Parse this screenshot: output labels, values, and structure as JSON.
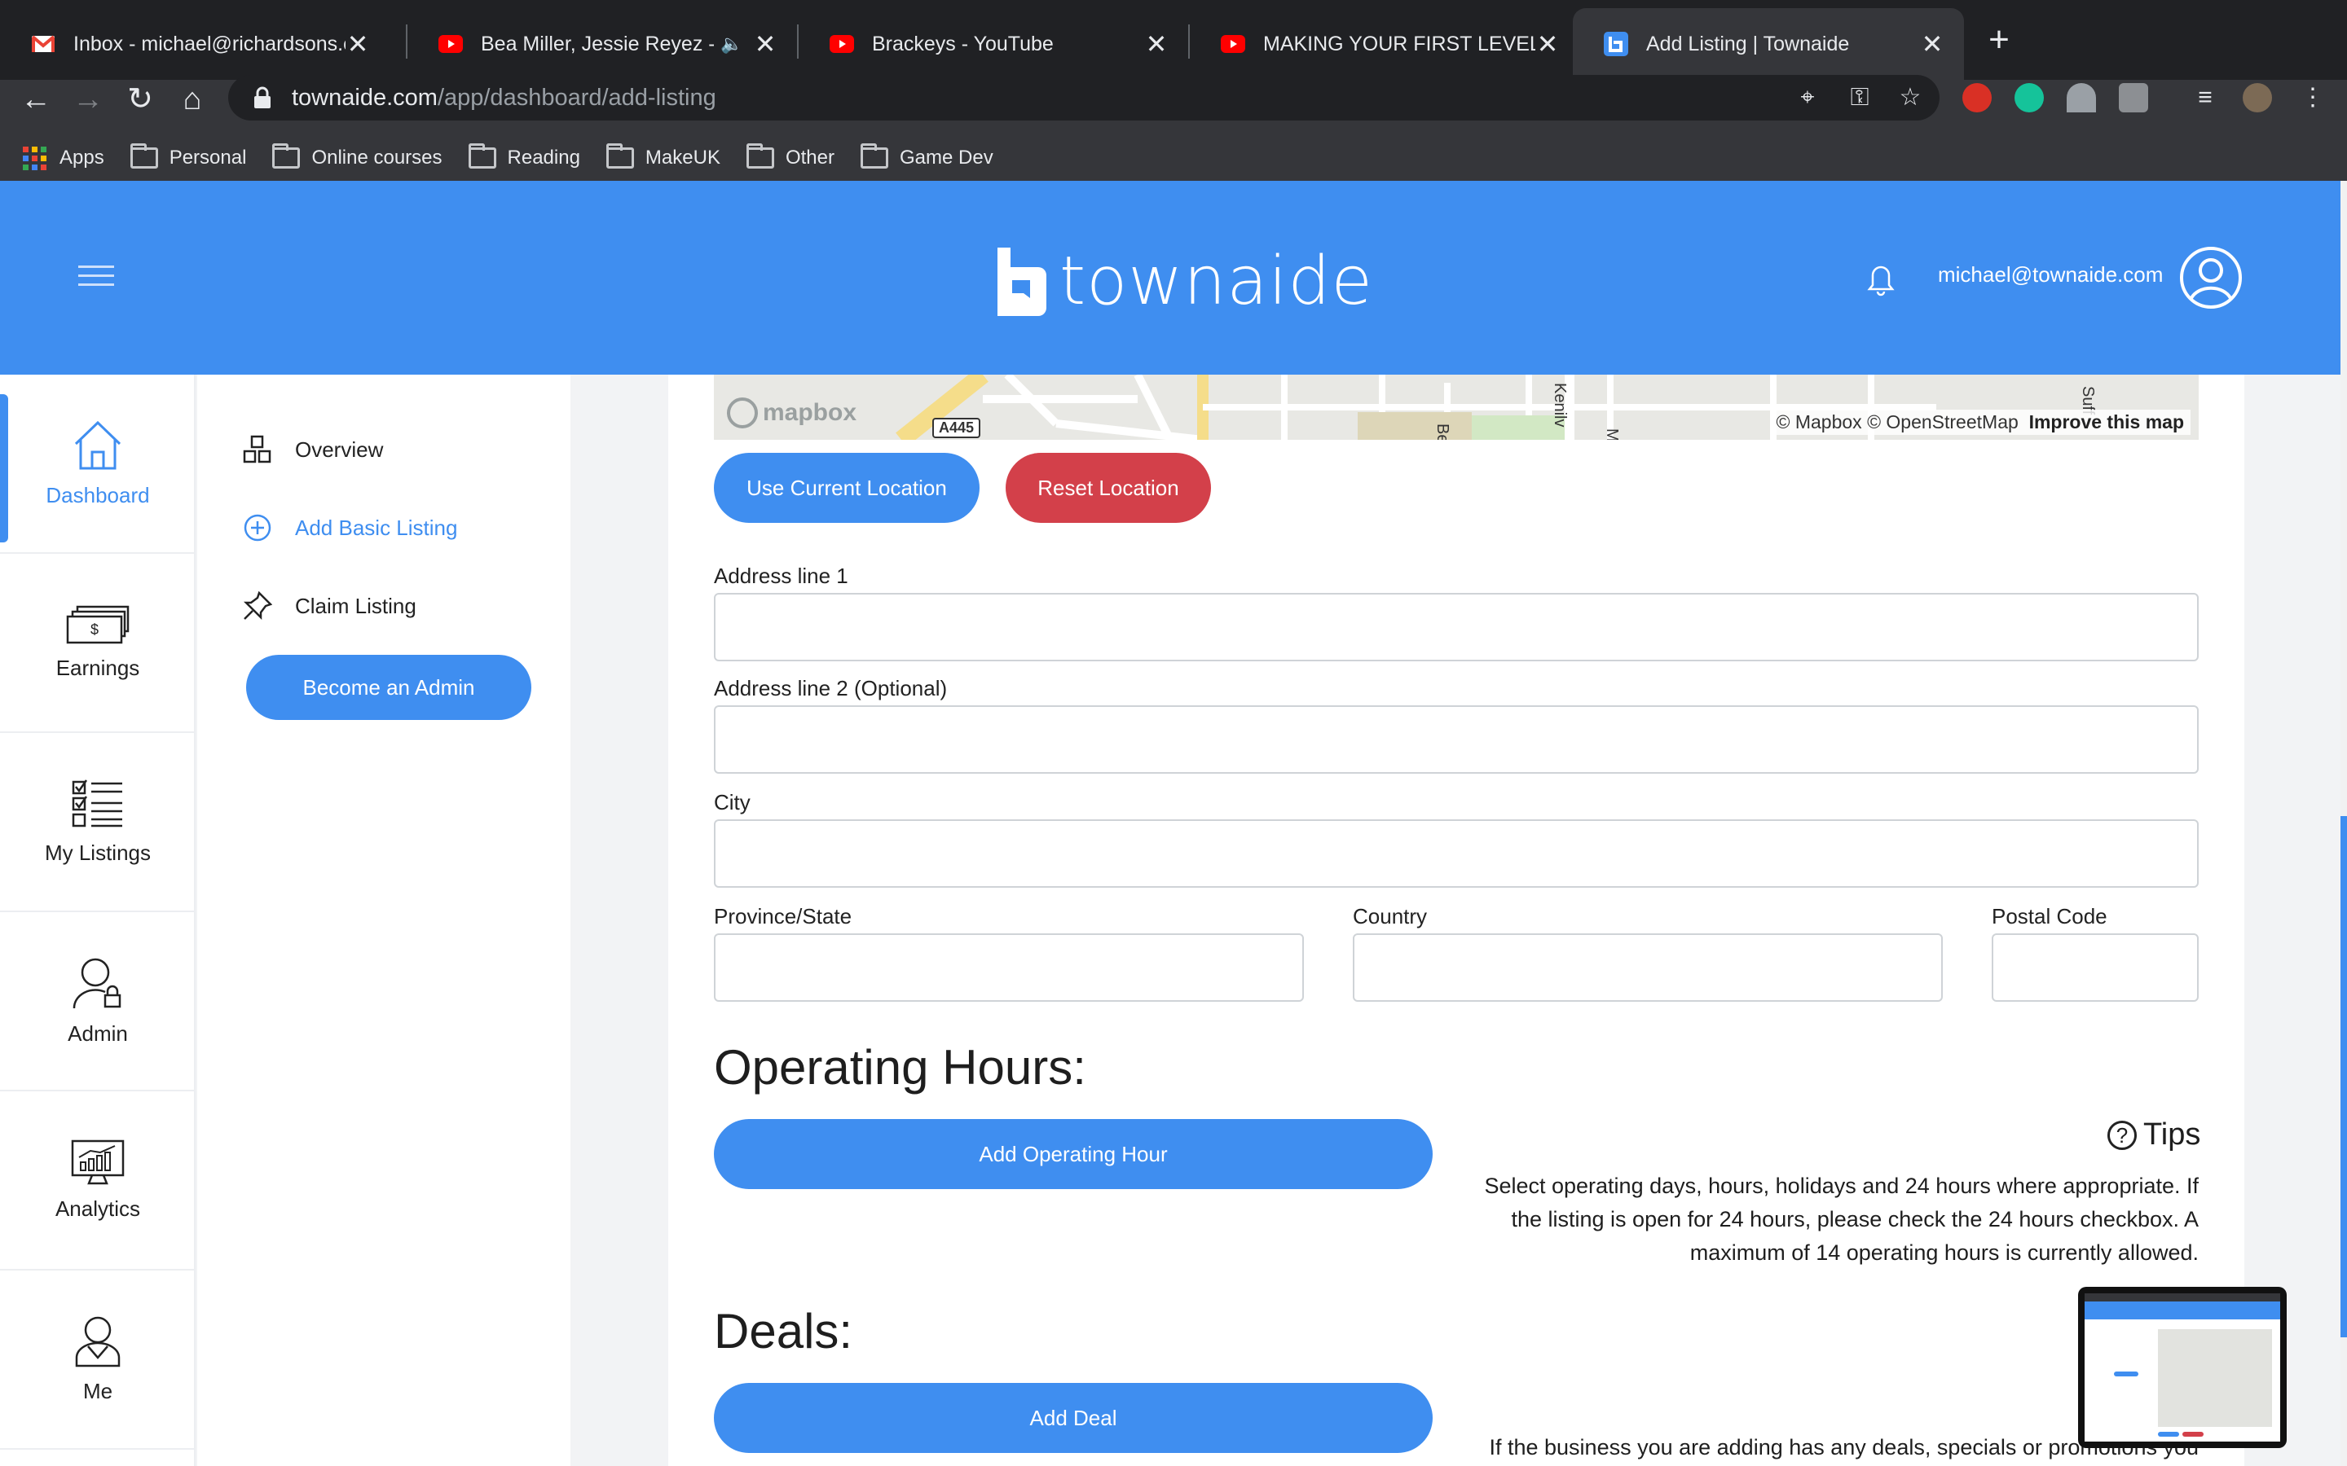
{
  "browser": {
    "tabs": [
      {
        "title": "Inbox - michael@richardsons.co",
        "icon": "gmail-icon",
        "muted": false,
        "active": false
      },
      {
        "title": "Bea Miller, Jessie Reyez - FE",
        "icon": "youtube-icon",
        "muted": true,
        "active": false
      },
      {
        "title": "Brackeys - YouTube",
        "icon": "youtube-icon",
        "muted": false,
        "active": false
      },
      {
        "title": "MAKING YOUR FIRST LEVEL in U",
        "icon": "youtube-icon",
        "muted": false,
        "active": false
      },
      {
        "title": "Add Listing | Townaide",
        "icon": "townaide-icon",
        "muted": false,
        "active": true
      }
    ],
    "url_host": "townaide.com",
    "url_path": "/app/dashboard/add-listing",
    "bookmarks": [
      "Apps",
      "Personal",
      "Online courses",
      "Reading",
      "MakeUK",
      "Other",
      "Game Dev"
    ]
  },
  "header": {
    "brand": "townaide",
    "user_email": "michael@townaide.com",
    "color": "#3f8ef0"
  },
  "rail": {
    "items": [
      {
        "label": "Dashboard",
        "icon": "house-icon",
        "active": true
      },
      {
        "label": "Earnings",
        "icon": "cash-icon",
        "active": false
      },
      {
        "label": "My Listings",
        "icon": "checklist-icon",
        "active": false
      },
      {
        "label": "Admin",
        "icon": "admin-user-icon",
        "active": false
      },
      {
        "label": "Analytics",
        "icon": "chart-monitor-icon",
        "active": false
      },
      {
        "label": "Me",
        "icon": "person-icon",
        "active": false
      }
    ]
  },
  "submenu": {
    "overview": "Overview",
    "add_basic": "Add Basic Listing",
    "claim": "Claim Listing",
    "become_admin": "Become an Admin"
  },
  "map": {
    "attribution": "© Mapbox © OpenStreetMap",
    "improve": "Improve this map",
    "logo": "mapbox",
    "road": "A445",
    "streets": [
      "Bea",
      "Kenilv",
      "M",
      "Suff"
    ]
  },
  "location_buttons": {
    "use_current": "Use Current Location",
    "reset": "Reset Location"
  },
  "form": {
    "address1_label": "Address line 1",
    "address2_label": "Address line 2 (Optional)",
    "city_label": "City",
    "province_label": "Province/State",
    "country_label": "Country",
    "postal_label": "Postal Code",
    "address1": "",
    "address2": "",
    "city": "",
    "province": "",
    "country": "",
    "postal": ""
  },
  "operating_hours": {
    "title": "Operating Hours:",
    "button": "Add Operating Hour",
    "tips_title": "Tips",
    "tips_text": "Select operating days, hours, holidays and 24 hours where appropriate. If the listing is open for 24 hours, please check the 24 hours checkbox. A maximum of 14 operating hours is currently allowed."
  },
  "deals": {
    "title": "Deals:",
    "button": "Add Deal",
    "text": "If the business you are adding has any deals, specials or promotions you"
  }
}
